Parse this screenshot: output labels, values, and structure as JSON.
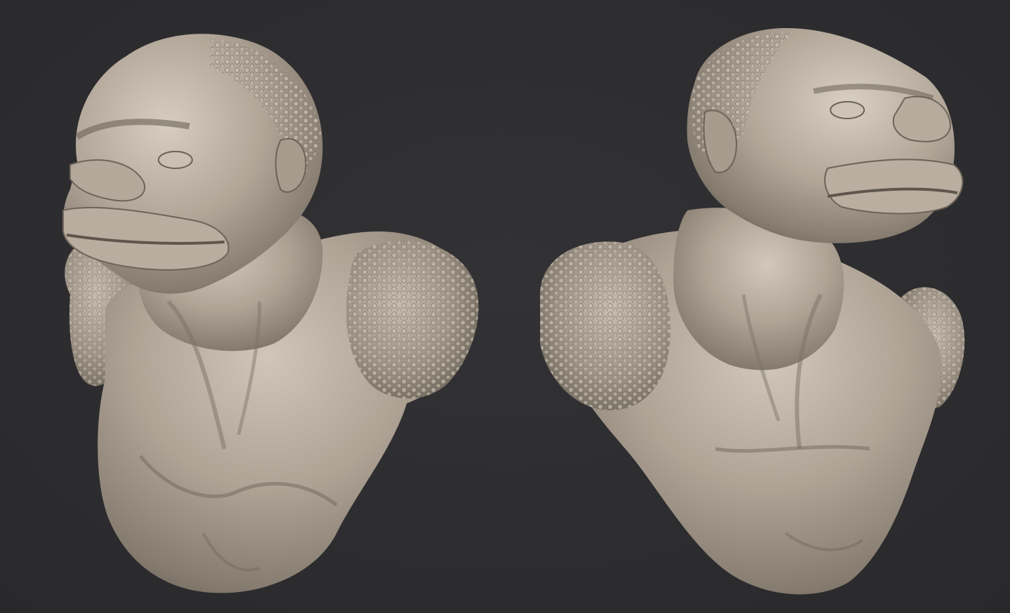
{
  "scene": {
    "background_color": "#2d2d2f",
    "material_color": "#a79c8e",
    "material_highlight": "#d3cabd",
    "material_shadow": "#5c544a"
  },
  "renders": [
    {
      "name": "bust-view-left-three-quarter",
      "icon": "creature-bust"
    },
    {
      "name": "bust-view-right-three-quarter",
      "icon": "creature-bust"
    }
  ]
}
